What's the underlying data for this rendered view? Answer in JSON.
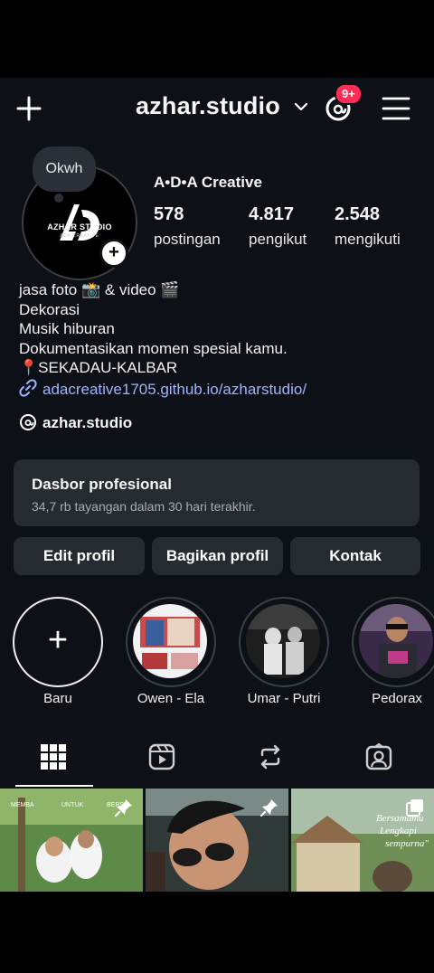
{
  "header": {
    "username": "azhar.studio",
    "notification_badge": "9+",
    "icons": [
      "plus-icon",
      "chevron-down-icon",
      "threads-icon",
      "menu-icon"
    ],
    "badge_color": "#ff2d55"
  },
  "profile": {
    "note": "Okwh",
    "avatar_brand": "AZHAR STUDIO",
    "avatar_tagline": "ADA CREATIVE",
    "display_name": "A•D•A Creative",
    "stats": [
      {
        "value": "578",
        "label": "postingan"
      },
      {
        "value": "4.817",
        "label": "pengikut"
      },
      {
        "value": "2.548",
        "label": "mengikuti"
      }
    ]
  },
  "bio": {
    "lines": [
      "jasa foto 📸 & video 🎬",
      "Dekorasi",
      "Musik hiburan",
      "Dokumentasikan momen spesial kamu.",
      "📍SEKADAU-KALBAR"
    ],
    "link": "adacreative1705.github.io/azharstudio/",
    "threads_handle": "azhar.studio",
    "link_color": "#9db4ff"
  },
  "dashboard": {
    "title": "Dasbor profesional",
    "subtitle": "34,7 rb tayangan dalam 30 hari terakhir."
  },
  "actions": {
    "edit": "Edit profil",
    "share": "Bagikan profil",
    "contact": "Kontak"
  },
  "highlights": [
    {
      "label": "Baru"
    },
    {
      "label": "Owen - Ela"
    },
    {
      "label": "Umar - Putri"
    },
    {
      "label": "Pedorax"
    }
  ],
  "tabs": [
    "grid-icon",
    "reels-icon",
    "reposts-icon",
    "tagged-icon"
  ],
  "grid": {
    "items": [
      {
        "overlay": [
          "MEMBA",
          "UNTUK",
          "BERS"
        ],
        "pinned": true
      },
      {
        "overlay": [],
        "pinned": true
      },
      {
        "overlay": [
          "Bersamamu",
          "Lengkapi",
          "sempurna\""
        ],
        "pinned": false
      }
    ]
  }
}
